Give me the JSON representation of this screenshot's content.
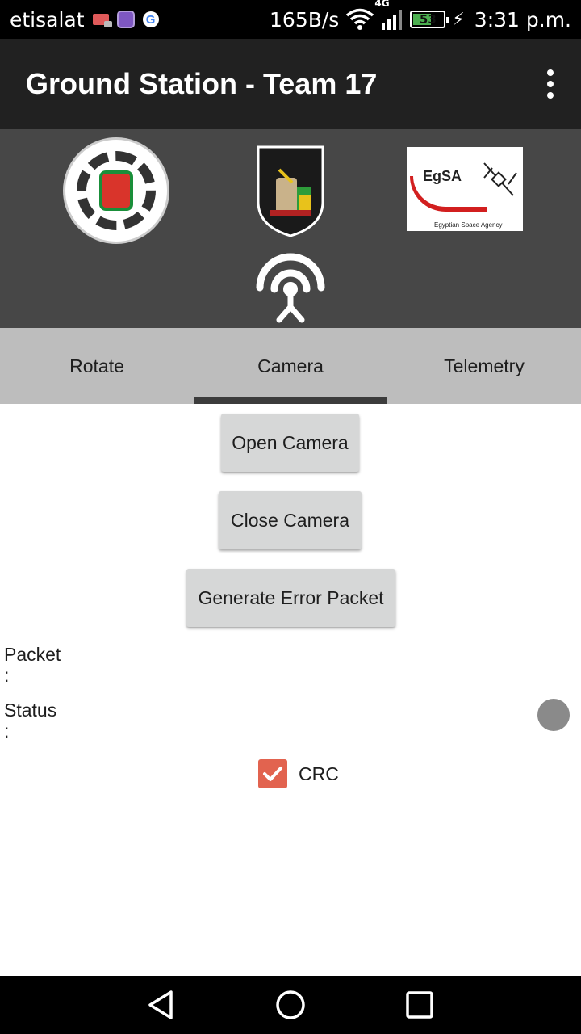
{
  "status_bar": {
    "carrier": "etisalat",
    "net_speed": "165B/s",
    "network_type": "4G",
    "battery": "53",
    "time": "3:31 p.m.",
    "icons": [
      "message-icon",
      "gallery-icon",
      "google-icon",
      "wifi-icon",
      "signal-icon",
      "battery-icon",
      "charging-icon"
    ]
  },
  "app_bar": {
    "title": "Ground Station - Team 17"
  },
  "banner": {
    "egsa_logo_text": "EgSA",
    "egsa_logo_subtext": "Egyptian Space Agency"
  },
  "tabs": [
    {
      "label": "Rotate",
      "active": false
    },
    {
      "label": "Camera",
      "active": true
    },
    {
      "label": "Telemetry",
      "active": false
    }
  ],
  "buttons": {
    "open_camera": "Open Camera",
    "close_camera": "Close Camera",
    "generate_error": "Generate Error Packet"
  },
  "fields": {
    "packet_label": "Packet",
    "packet_colon": ":",
    "status_label": "Status",
    "status_colon": ":"
  },
  "crc": {
    "label": "CRC",
    "checked": true
  },
  "colors": {
    "app_bar": "#212121",
    "banner": "#474747",
    "tab_bar": "#bdbdbd",
    "tab_indicator": "#3c3c3c",
    "button": "#d6d7d7",
    "checkbox": "#e2634f",
    "status_dot": "#8a8a8a"
  }
}
